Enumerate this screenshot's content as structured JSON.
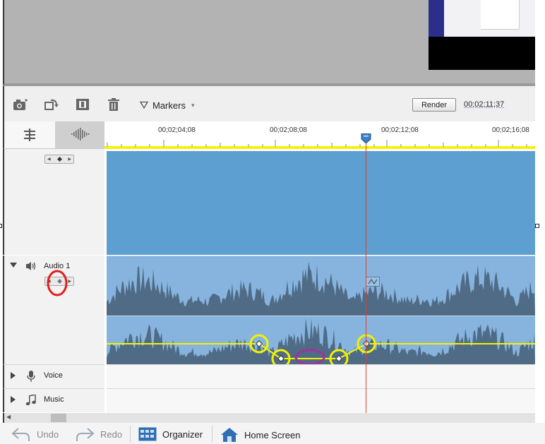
{
  "toolbar": {
    "markers_label": "Markers",
    "render_label": "Render",
    "timecode": "00;02;11;37"
  },
  "ruler": {
    "ticks": [
      "00;02;04;08",
      "00;02;08;08",
      "00;02;12;08",
      "00;02;16;08"
    ]
  },
  "tracks": {
    "audio1": "Audio 1",
    "voice": "Voice",
    "music": "Music"
  },
  "bottombar": {
    "undo": "Undo",
    "redo": "Redo",
    "organizer": "Organizer",
    "home": "Home Screen"
  },
  "colors": {
    "video_clip": "#5e9fd1",
    "audio_clip": "#86b4de",
    "waveform": "#4f6b85",
    "volume_line": "#f6f200",
    "playhead": "#e0402b",
    "annotation_yellow": "#f2f200",
    "annotation_red": "#e21c1c",
    "annotation_purple": "#a0329a"
  },
  "icons": [
    "camera-icon",
    "rotate-icon",
    "freeze-frame-icon",
    "trash-icon",
    "markers-icon",
    "timeline-view-icon",
    "waveform-view-icon",
    "speaker-icon",
    "microphone-icon",
    "music-note-icon",
    "undo-icon",
    "redo-icon",
    "organizer-grid-icon",
    "home-icon"
  ]
}
